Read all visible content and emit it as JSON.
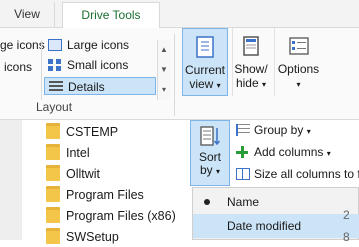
{
  "tabs": {
    "view": "View",
    "drive_tools": "Drive Tools"
  },
  "layout": {
    "items": {
      "large_icons_left": "ge icons",
      "icons_left": "icons",
      "large_icons": "Large icons",
      "small_icons": "Small icons",
      "details": "Details"
    },
    "group_label": "Layout"
  },
  "current_view": {
    "line1": "Current",
    "line2": "view",
    "arrow": "▾"
  },
  "show_hide": {
    "line1": "Show/",
    "line2": "hide",
    "arrow": "▾"
  },
  "options": {
    "label": "Options",
    "arrow": "▾"
  },
  "sort_by": {
    "line1": "Sort",
    "line2": "by",
    "arrow": "▾"
  },
  "group_by": {
    "label": "Group by",
    "arrow": "▾"
  },
  "add_columns": {
    "label": "Add columns",
    "arrow": "▾"
  },
  "size_all_columns": {
    "label": "Size all columns to fi"
  },
  "folders": [
    "CSTEMP",
    "Intel",
    "Olltwit",
    "Program Files",
    "Program Files (x86)",
    "SWSetup"
  ],
  "menu": {
    "name": "Name",
    "date_modified": "Date modified"
  },
  "column_cut": {
    "top": "2",
    "bottom": "8"
  },
  "colors": {
    "selection": "#cce4f7",
    "selection_border": "#7eb4ea",
    "folder": "#f3c64a",
    "tab_accent": "#1b6e2f"
  }
}
